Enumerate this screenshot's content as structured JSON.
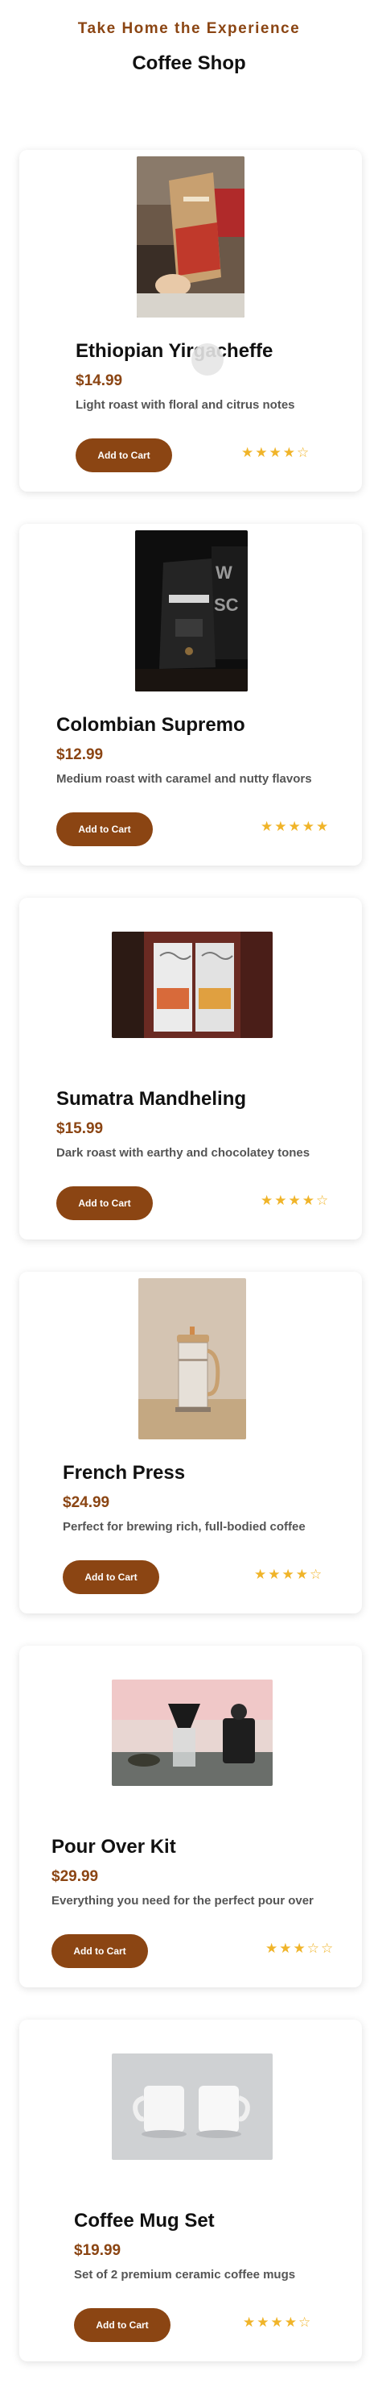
{
  "header": {
    "tagline": "Take Home the Experience",
    "title": "Coffee Shop"
  },
  "products": [
    {
      "name": "Ethiopian Yirgacheffe",
      "price": "$14.99",
      "description": "Light roast with floral and citrus notes",
      "button": "Add to Cart",
      "rating": 4,
      "stars": "★★★★☆",
      "image": "coffee-bag-held-photo"
    },
    {
      "name": "Colombian Supremo",
      "price": "$12.99",
      "description": "Medium roast with caramel and nutty flavors",
      "button": "Add to Cart",
      "rating": 5,
      "stars": "★★★★★",
      "image": "dark-coffee-bag-photo"
    },
    {
      "name": "Sumatra Mandheling",
      "price": "$15.99",
      "description": "Dark roast with earthy and chocolatey tones",
      "button": "Add to Cart",
      "rating": 4,
      "stars": "★★★★☆",
      "image": "coffee-bags-pair-photo"
    },
    {
      "name": "French Press",
      "price": "$24.99",
      "description": "Perfect for brewing rich, full-bodied coffee",
      "button": "Add to Cart",
      "rating": 4,
      "stars": "★★★★☆",
      "image": "french-press-photo"
    },
    {
      "name": "Pour Over Kit",
      "price": "$29.99",
      "description": "Everything you need for the perfect pour over",
      "button": "Add to Cart",
      "rating": 3,
      "stars": "★★★☆☆",
      "image": "pour-over-setup-photo"
    },
    {
      "name": "Coffee Mug Set",
      "price": "$19.99",
      "description": "Set of 2 premium ceramic coffee mugs",
      "button": "Add to Cart",
      "rating": 4,
      "stars": "★★★★☆",
      "image": "white-mugs-photo"
    }
  ],
  "colors": {
    "accent": "#8B4513",
    "star": "#F0B429"
  }
}
